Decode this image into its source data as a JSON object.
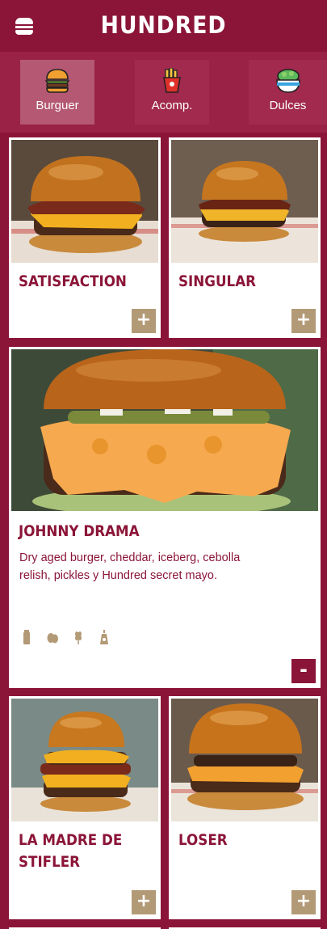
{
  "header": {
    "brand": "HUNDRED",
    "menu_icon": "burger-menu-icon"
  },
  "tabs": [
    {
      "label": "Burguer",
      "icon": "burger-icon",
      "active": true
    },
    {
      "label": "Acomp.",
      "icon": "fries-icon",
      "active": false
    },
    {
      "label": "Dulces",
      "icon": "dessert-icon",
      "active": false
    }
  ],
  "products": [
    {
      "name": "SATISFACTION",
      "button": "+"
    },
    {
      "name": "SINGULAR",
      "button": "+"
    },
    {
      "name": "JOHNNY DRAMA",
      "description": "Dry aged burger, cheddar, iceberg, cebolla relish, pickles y Hundred secret mayo.",
      "allergens": [
        "milk-allergen-icon",
        "egg-allergen-icon",
        "gluten-allergen-icon",
        "mustard-allergen-icon"
      ],
      "button": "-"
    },
    {
      "name": "LA MADRE DE STIFLER",
      "button": "+"
    },
    {
      "name": "LOSER",
      "button": "+"
    }
  ],
  "colors": {
    "brand": "#8b1538",
    "tab_bar": "#9a2247",
    "active_tab": "#b45873",
    "add_button": "#b39a76"
  }
}
